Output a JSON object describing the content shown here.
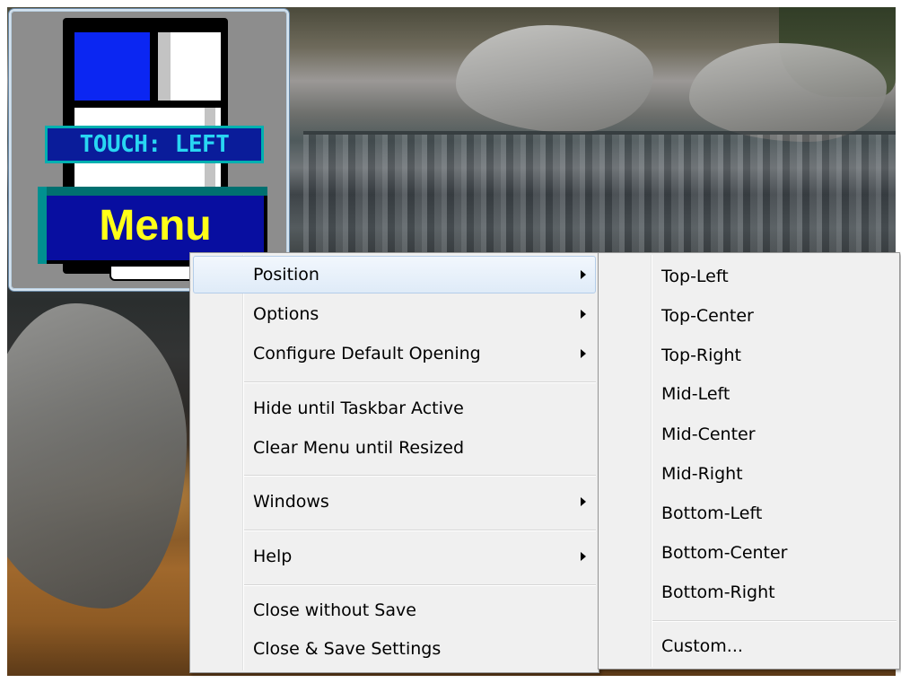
{
  "widget": {
    "touch_label": "TOUCH: LEFT",
    "menu_button_label": "Menu",
    "colors": {
      "button_face": "#080ea0",
      "button_text": "#ffff18",
      "label_text": "#28d6f2",
      "phone_block": "#0b26f2"
    }
  },
  "main_menu": {
    "items": [
      {
        "label": "Position",
        "has_submenu": true,
        "highlighted": true
      },
      {
        "label": "Options",
        "has_submenu": true
      },
      {
        "label": "Configure Default Opening",
        "has_submenu": true
      },
      {
        "label": "Hide until Taskbar Active",
        "has_submenu": false
      },
      {
        "label": "Clear Menu until Resized",
        "has_submenu": false
      },
      {
        "label": "Windows",
        "has_submenu": true
      },
      {
        "label": "Help",
        "has_submenu": true
      },
      {
        "label": "Close without Save",
        "has_submenu": false
      },
      {
        "label": "Close & Save Settings",
        "has_submenu": false
      }
    ]
  },
  "position_submenu": {
    "items": [
      {
        "label": "Top-Left"
      },
      {
        "label": "Top-Center"
      },
      {
        "label": "Top-Right"
      },
      {
        "label": "Mid-Left"
      },
      {
        "label": "Mid-Center"
      },
      {
        "label": "Mid-Right"
      },
      {
        "label": "Bottom-Left"
      },
      {
        "label": "Bottom-Center"
      },
      {
        "label": "Bottom-Right"
      },
      {
        "label": "Custom..."
      }
    ]
  },
  "colors": {
    "menu_bg": "#f0f0f0",
    "highlight_border": "#b4cde9"
  }
}
